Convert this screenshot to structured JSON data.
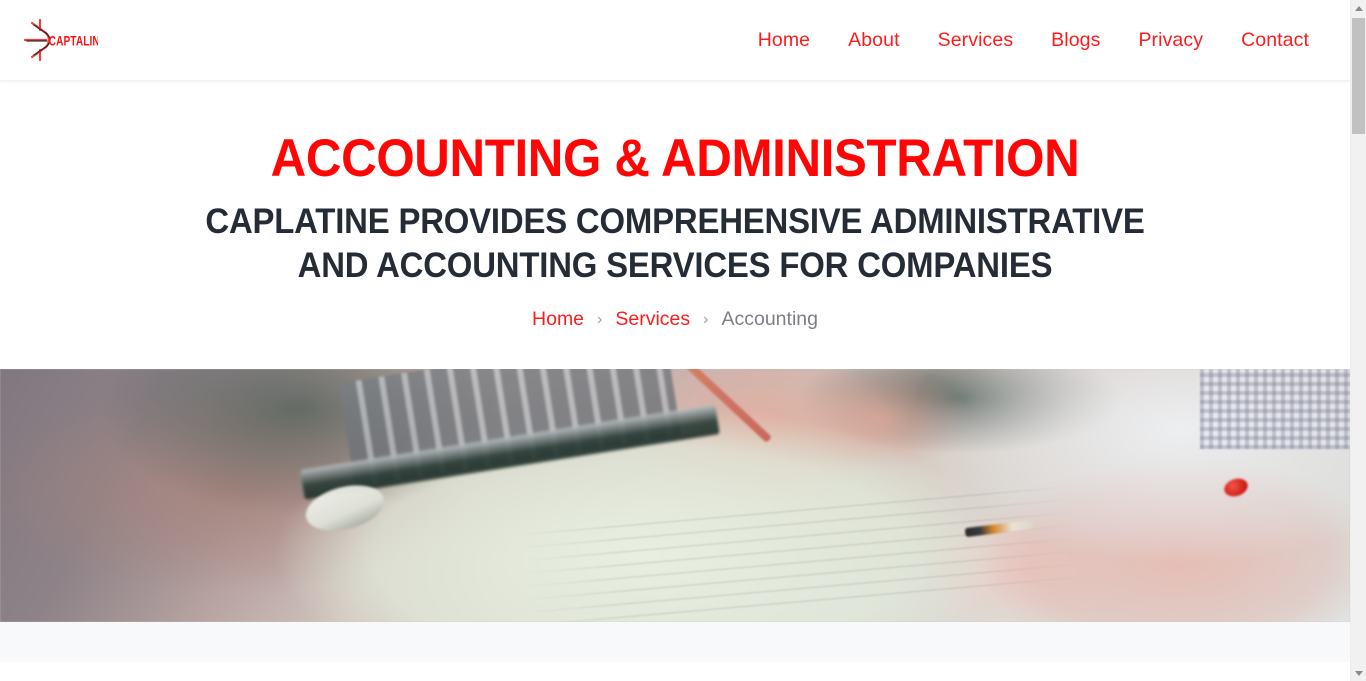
{
  "header": {
    "logo": {
      "name": "caplatine-logo",
      "wordmark": "CAPTALINE",
      "mark_color": "#f2403c",
      "accent_color": "#ff1212"
    },
    "nav": [
      {
        "label": "Home",
        "name": "nav-link-home"
      },
      {
        "label": "About",
        "name": "nav-link-about"
      },
      {
        "label": "Services",
        "name": "nav-link-services"
      },
      {
        "label": "Blogs",
        "name": "nav-link-blogs"
      },
      {
        "label": "Privacy",
        "name": "nav-link-privacy"
      },
      {
        "label": "Contact",
        "name": "nav-link-contact"
      }
    ]
  },
  "hero": {
    "title": "ACCOUNTING & ADMINISTRATION",
    "subtitle_line1": "CAPLATINE PROVIDES COMPREHENSIVE ADMINISTRATIVE",
    "subtitle_line2": "AND ACCOUNTING SERVICES FOR COMPANIES",
    "title_color": "#ff0505",
    "subtitle_color": "#262c35",
    "image_alt": "Hands writing figures in a ledger notebook beside an open laptop on a wooden desk"
  },
  "breadcrumb": {
    "items": [
      {
        "label": "Home",
        "current": false
      },
      {
        "label": "Services",
        "current": false
      },
      {
        "label": "Accounting",
        "current": true
      }
    ],
    "separator": "›",
    "link_color": "#fd1c1c",
    "current_color": "#7b7f86"
  },
  "scrollbar": {
    "name": "vertical-scrollbar",
    "up_arrow": "▲",
    "down_arrow": "▼"
  }
}
